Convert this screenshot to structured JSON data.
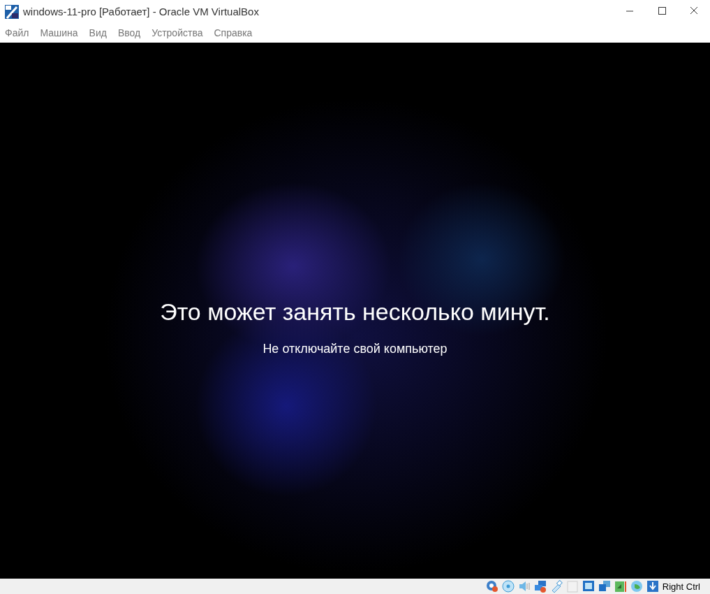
{
  "window": {
    "title": "windows-11-pro [Работает] - Oracle VM VirtualBox"
  },
  "menu": [
    {
      "label": "Файл"
    },
    {
      "label": "Машина"
    },
    {
      "label": "Вид"
    },
    {
      "label": "Ввод"
    },
    {
      "label": "Устройства"
    },
    {
      "label": "Справка"
    }
  ],
  "screen": {
    "heading": "Это может занять несколько минут.",
    "subheading": "Не отключайте свой компьютер"
  },
  "status_bar": {
    "host_key": "Right Ctrl"
  }
}
